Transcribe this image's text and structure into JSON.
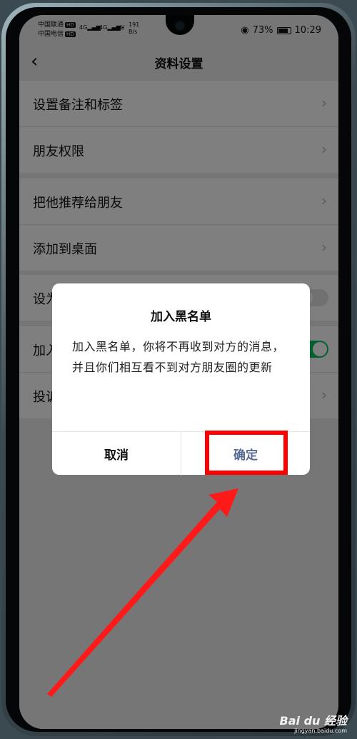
{
  "status_bar": {
    "carrier_1": "中国联通",
    "carrier_2": "中国电信",
    "hd": "HD",
    "signal": "4G",
    "net_speed_value": "191",
    "net_speed_unit": "B/s",
    "battery_percent": "73%",
    "time": "10:29"
  },
  "nav": {
    "back_glyph": "‹",
    "title": "资料设置"
  },
  "settings": {
    "group1": [
      "设置备注和标签",
      "朋友权限"
    ],
    "group2": [
      "把他推荐给朋友",
      "添加到桌面"
    ],
    "group3_row1": "设为星标朋友",
    "group4": {
      "row1": "加入黑名单",
      "row2": "投诉"
    }
  },
  "dialog": {
    "title": "加入黑名单",
    "message": "加入黑名单，你将不再收到对方的消息，并且你们相互看不到对方朋友圈的更新",
    "cancel_label": "取消",
    "confirm_label": "确定"
  },
  "watermark": {
    "logo": "Bai du 经验",
    "url": "jingyan.baidu.com"
  },
  "colors": {
    "accent_link": "#576b95",
    "toggle_on": "#07c160",
    "annotation_red": "#ff0000",
    "overlay": "rgba(0,0,0,0.5)"
  },
  "icons": [
    "back-chevron-icon",
    "chevron-right-icon",
    "eye-icon",
    "battery-icon",
    "wifi-icon",
    "signal-icon"
  ]
}
